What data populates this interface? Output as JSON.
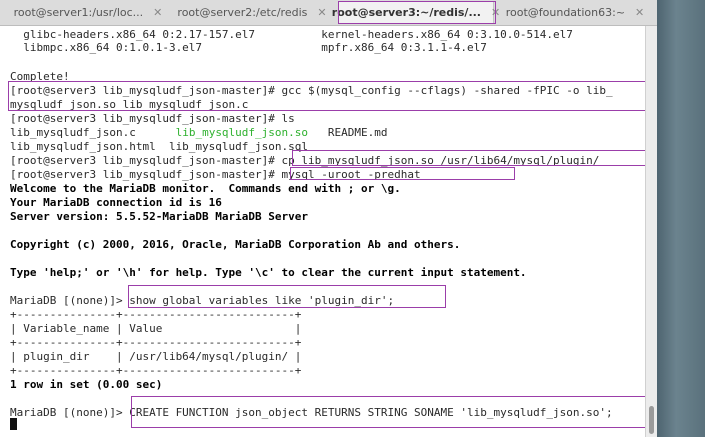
{
  "tabs": [
    {
      "label": "root@server1:/usr/loc...",
      "close": "✕"
    },
    {
      "label": "root@server2:/etc/redis",
      "close": "✕"
    },
    {
      "label": "root@server3:~/redis/...",
      "close": "✕"
    },
    {
      "label": "root@foundation63:~",
      "close": "✕"
    }
  ],
  "colors": {
    "highlight": "#9b3ea9",
    "green_file": "#2fb12f"
  },
  "terminal": {
    "line0": "  glibc-headers.x86_64 0:2.17-157.el7          kernel-headers.x86_64 0:3.10.0-514.el7",
    "line1": "  libmpc.x86_64 0:1.0.1-3.el7                  mpfr.x86_64 0:3.1.1-4.el7",
    "line2": "",
    "line3": "Complete!",
    "line4": "[root@server3 lib_mysqludf_json-master]# gcc $(mysql_config --cflags) -shared -fPIC -o lib_",
    "line5": "mysqludf_json.so lib_mysqludf_json.c",
    "line6": "[root@server3 lib_mysqludf_json-master]# ls",
    "line7a": "lib_mysqludf_json.c      ",
    "line7b": "lib_mysqludf_json.so",
    "line7c": "   README.md",
    "line8": "lib_mysqludf_json.html  lib_mysqludf_json.sql",
    "line9": "[root@server3 lib_mysqludf_json-master]# cp lib_mysqludf_json.so /usr/lib64/mysql/plugin/",
    "line10": "[root@server3 lib_mysqludf_json-master]# mysql -uroot -predhat",
    "line11": "Welcome to the MariaDB monitor.  Commands end with ; or \\g.",
    "line12": "Your MariaDB connection id is 16",
    "line13": "Server version: 5.5.52-MariaDB MariaDB Server",
    "line14": "",
    "line15": "Copyright (c) 2000, 2016, Oracle, MariaDB Corporation Ab and others.",
    "line16": "",
    "line17": "Type 'help;' or '\\h' for help. Type '\\c' to clear the current input statement.",
    "line18": "",
    "line19": "MariaDB [(none)]> show global variables like 'plugin_dir';",
    "line20": "+---------------+--------------------------+",
    "line21": "| Variable_name | Value                    |",
    "line22": "+---------------+--------------------------+",
    "line23": "| plugin_dir    | /usr/lib64/mysql/plugin/ |",
    "line24": "+---------------+--------------------------+",
    "line25": "1 row in set (0.00 sec)",
    "line26": "",
    "line27": "MariaDB [(none)]> CREATE FUNCTION json_object RETURNS STRING SONAME 'lib_mysqludf_json.so';"
  }
}
